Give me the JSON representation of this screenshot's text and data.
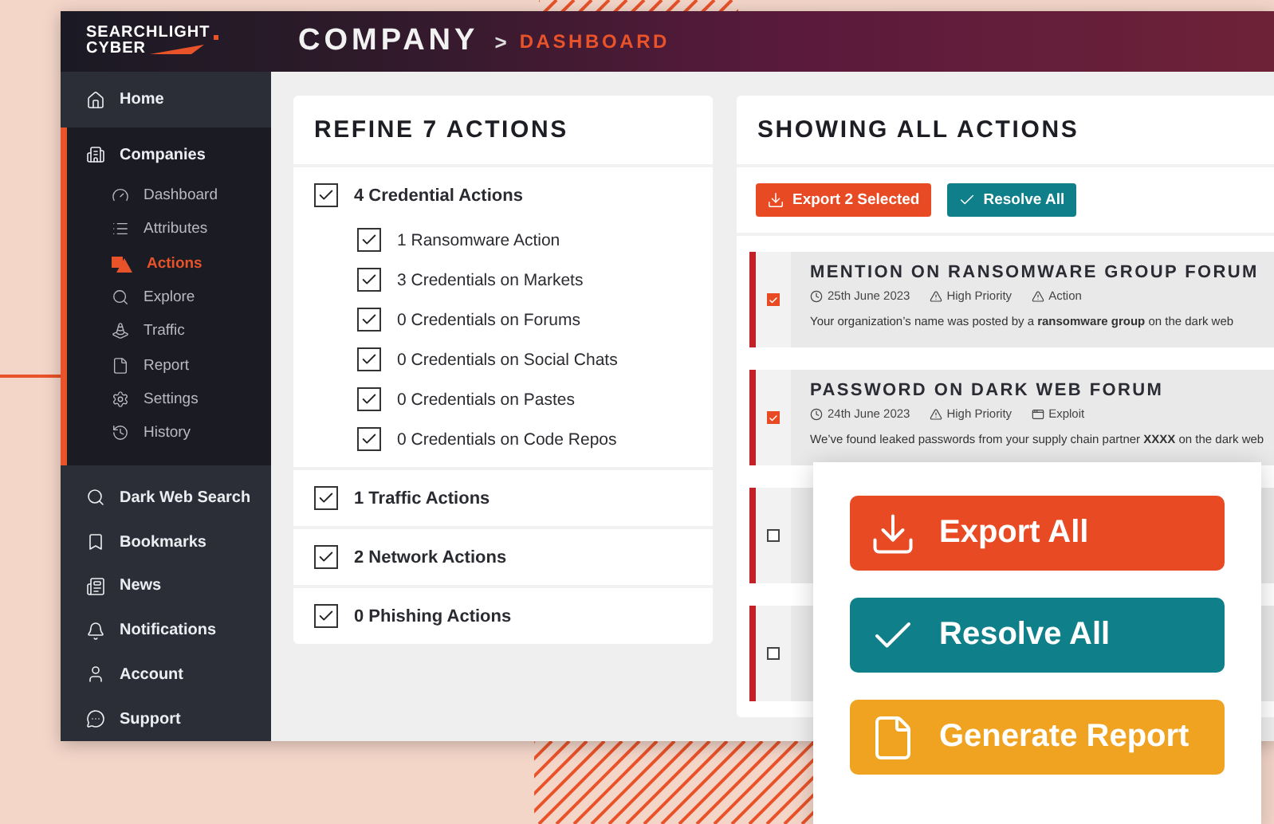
{
  "logo": {
    "line1": "SEARCHLIGHT",
    "line2": "CYBER"
  },
  "breadcrumb": {
    "title": "COMPANY",
    "separator": ">",
    "current": "DASHBOARD"
  },
  "sidebar": {
    "items": [
      {
        "label": "Home",
        "selected": false
      },
      {
        "label": "Companies",
        "selected": false,
        "children": [
          {
            "label": "Dashboard",
            "selected": false
          },
          {
            "label": "Attributes",
            "selected": false
          },
          {
            "label": "Actions",
            "selected": true
          },
          {
            "label": "Explore",
            "selected": false
          },
          {
            "label": "Traffic",
            "selected": false
          },
          {
            "label": "Report",
            "selected": false
          },
          {
            "label": "Settings",
            "selected": false
          },
          {
            "label": "History",
            "selected": false
          }
        ]
      },
      {
        "label": "Dark Web Search",
        "selected": false
      },
      {
        "label": "Bookmarks",
        "selected": false
      },
      {
        "label": "News",
        "selected": false
      },
      {
        "label": "Notifications",
        "selected": false
      },
      {
        "label": "Account",
        "selected": false
      },
      {
        "label": "Support",
        "selected": false
      }
    ]
  },
  "filters": {
    "title": "REFINE 7 ACTIONS",
    "groups": [
      {
        "label": "4 Credential Actions",
        "checked": true,
        "children": [
          {
            "label": "1 Ransomware Action",
            "checked": true
          },
          {
            "label": "3 Credentials on Markets",
            "checked": true
          },
          {
            "label": "0 Credentials on Forums",
            "checked": true
          },
          {
            "label": "0 Credentials on Social Chats",
            "checked": true
          },
          {
            "label": "0 Credentials on Pastes",
            "checked": true
          },
          {
            "label": "0 Credentials on Code Repos",
            "checked": true
          }
        ]
      },
      {
        "label": "1 Traffic Actions",
        "checked": true
      },
      {
        "label": "2 Network Actions",
        "checked": true
      },
      {
        "label": "0 Phishing Actions",
        "checked": true
      }
    ]
  },
  "actions": {
    "title": "SHOWING ALL ACTIONS",
    "buttons": [
      {
        "kind": "export",
        "label": "Export 2 Selected"
      },
      {
        "kind": "resolve",
        "label": "Resolve All"
      }
    ],
    "rows": [
      {
        "title": "MENTION ON RANSOMWARE GROUP FORUM",
        "checked": true,
        "meta": [
          {
            "kind": "date",
            "text": "25th June 2023"
          },
          {
            "kind": "priority",
            "text": "High Priority"
          },
          {
            "kind": "action",
            "text": "Action"
          }
        ],
        "description": "Your organization’s name was posted by a **ransomware group** on the dark web"
      },
      {
        "title": "PASSWORD ON DARK WEB FORUM",
        "checked": true,
        "meta": [
          {
            "kind": "date",
            "text": "24th June 2023"
          },
          {
            "kind": "priority",
            "text": "High Priority"
          },
          {
            "kind": "exploit",
            "text": "Exploit"
          }
        ],
        "description": "We’ve found leaked passwords from your supply chain partner **XXXX** on the dark web"
      },
      {
        "checked": false
      },
      {
        "checked": false
      }
    ]
  },
  "quick_actions": {
    "buttons": [
      {
        "kind": "export",
        "label": "Export All"
      },
      {
        "kind": "resolve",
        "label": "Resolve All"
      },
      {
        "kind": "report",
        "label": "Generate Report"
      }
    ]
  }
}
